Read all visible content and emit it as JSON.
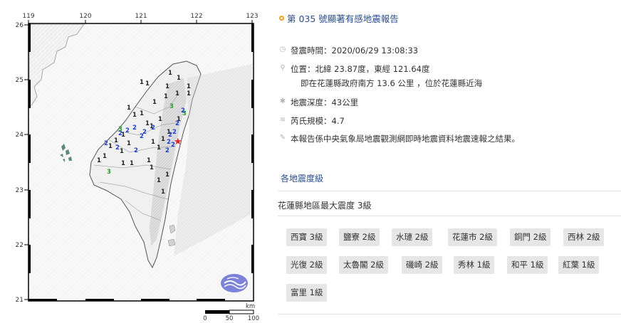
{
  "map": {
    "lon_ticks": [
      "119",
      "120",
      "121",
      "122",
      "123"
    ],
    "lat_ticks": [
      "26",
      "25",
      "24",
      "23",
      "22",
      "21"
    ],
    "scale_unit": "km",
    "scale_labels": [
      "0",
      "50",
      "100"
    ],
    "station_digits": [
      "1",
      "1",
      "1",
      "1",
      "1",
      "1",
      "1",
      "1",
      "1",
      "1",
      "1",
      "1",
      "1",
      "1",
      "1",
      "1",
      "1",
      "1",
      "1",
      "1",
      "1",
      "1",
      "1",
      "1",
      "1",
      "1",
      "1",
      "1",
      "1",
      "1",
      "2",
      "2",
      "2",
      "2",
      "2",
      "2",
      "2",
      "2",
      "2",
      "2",
      "2",
      "2",
      "2",
      "2",
      "2",
      "2",
      "3",
      "3",
      "3",
      "3",
      "1",
      "1",
      "1",
      "1",
      "1"
    ],
    "epicenter_symbol": "★"
  },
  "report": {
    "title": "第 035 號顯著有感地震報告",
    "time_label": "發震時間：2020/06/29 13:08:33",
    "location_label": "位置：北緯 23.87度，東經 121.64度",
    "location_sub": "即在花蓮縣政府南方 13.6 公里 ，位於花蓮縣近海",
    "depth_label": "地震深度：43公里",
    "magnitude_label": "芮氏規模：4.7",
    "note": "本報告係中央氣象局地震觀測網即時地震資料地震速報之結果。",
    "section_title": "各地震度級",
    "max_intensity": "花蓮縣地區最大震度 3級",
    "stations": [
      "西寶 3級",
      "鹽寮 2級",
      "水璉 2級",
      "花蓮市 2級",
      "銅門 2級",
      "西林 2級",
      "光復 2級",
      "太魯閣 2級",
      "磯崎 2級",
      "秀林 1級",
      "和平 1級",
      "紅葉 1級",
      "富里 1級"
    ]
  },
  "colors": {
    "accent": "#2b4d8c",
    "title_dot": "#f0a020",
    "tile_bg": "#e6e6e6",
    "intensity_1": "#222222",
    "intensity_2": "#1f3fd0",
    "intensity_3": "#2a9a2a",
    "epicenter": "#e02020"
  },
  "icons": {
    "title": "circle-dot-icon",
    "time": "clock-icon",
    "location": "map-pin-icon",
    "depth": "star-icon",
    "magnitude": "wave-icon",
    "note": "pencil-icon"
  }
}
